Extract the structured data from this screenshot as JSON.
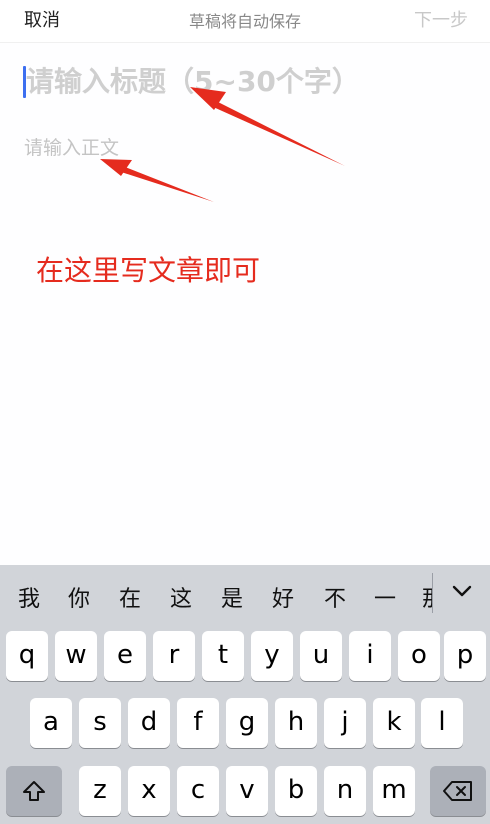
{
  "header": {
    "cancel_label": "取消",
    "autosave_text": "草稿将自动保存",
    "next_label": "下一步"
  },
  "editor": {
    "title_placeholder": "请输入标题（5~30个字）",
    "body_placeholder": "请输入正文"
  },
  "annotation": {
    "text": "在这里写文章即可",
    "color": "#e52b1e"
  },
  "keyboard": {
    "candidates": [
      "我",
      "你",
      "在",
      "这",
      "是",
      "好",
      "不",
      "一",
      "那"
    ],
    "collapse_icon": "chevron-down-icon",
    "row1": [
      "q",
      "w",
      "e",
      "r",
      "t",
      "y",
      "u",
      "i",
      "o",
      "p"
    ],
    "row2": [
      "a",
      "s",
      "d",
      "f",
      "g",
      "h",
      "j",
      "k",
      "l"
    ],
    "row3": [
      "z",
      "x",
      "c",
      "v",
      "b",
      "n",
      "m"
    ],
    "shift_icon": "shift-icon",
    "delete_icon": "backspace-icon"
  },
  "colors": {
    "caret": "#3d6ff0",
    "keyboard_bg": "#d1d4d9",
    "special_key_bg": "#acb0b8"
  }
}
